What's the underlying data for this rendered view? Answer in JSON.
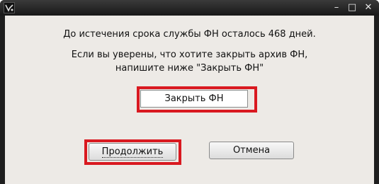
{
  "titlebar": {
    "minimize_glyph": "–",
    "maximize_glyph": "□",
    "close_glyph": "✕"
  },
  "dialog": {
    "message_days": "До истечения срока службы ФН осталось 468 дней.",
    "message_confirm_line1": "Если вы уверены, что хотите закрыть архив ФН,",
    "message_confirm_line2": "напишите ниже \"Закрыть ФН\"",
    "input_value": "Закрыть ФН",
    "continue_label": "Продолжить",
    "cancel_label": "Отмена"
  },
  "colors": {
    "highlight": "#d91920",
    "window_frame": "#1e1e1e",
    "client_bg": "#edeae6"
  }
}
